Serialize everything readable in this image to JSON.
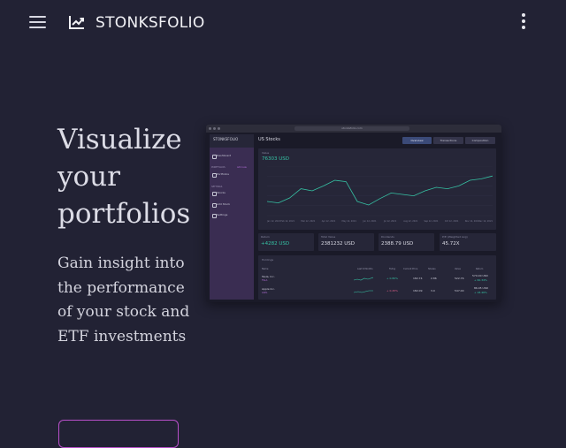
{
  "header": {
    "brand": "STONKSFOLIO",
    "menu_icon": "hamburger-menu-icon",
    "logo_icon": "trending-up-icon",
    "more_icon": "more-vertical-icon"
  },
  "hero": {
    "title": "Visualize your portfolios",
    "subtitle": "Gain insight into the performance of your stock and ETF investments"
  },
  "colors": {
    "background": "#222234",
    "accent": "#b84fc9",
    "positive": "#36c2a4"
  },
  "preview": {
    "url": "stonksfolio.com",
    "sidebar": {
      "brand": "STONKSFOLIO",
      "items": [
        "Dashboard",
        "Portfolios",
        "Stocks",
        "Add Stock",
        "Settings",
        "Logout"
      ],
      "sections": [
        "PORTFOLIOS",
        "SETTINGS"
      ],
      "action": "Add new"
    },
    "title": "US Stocks",
    "tabs": [
      "Overview",
      "Transactions",
      "Composition"
    ],
    "chart": {
      "label": "Value",
      "value": "76303 USD"
    },
    "stats": [
      {
        "label": "Return",
        "value": "+4282 USD",
        "positive": true
      },
      {
        "label": "Total Value",
        "value": "2381232 USD",
        "positive": false
      },
      {
        "label": "Dividends",
        "value": "2388.79 USD",
        "positive": false
      },
      {
        "label": "P/E (Weighted Avg)",
        "value": "45.72X",
        "positive": false
      }
    ],
    "holdings": {
      "title": "Holdings",
      "columns": [
        "Name",
        "Last 6 Months",
        "Today",
        "Current Price",
        "Shares",
        "Value",
        "Return"
      ],
      "rows": [
        {
          "name": "Tesla, Inc.",
          "ticker": "TSLA",
          "today": "+ 0.80%",
          "price": "182.74",
          "shares": "2.86",
          "value": "522.76",
          "return": "570.00 USD",
          "return_pct": "+ 60.34%"
        },
        {
          "name": "Apple Inc.",
          "ticker": "AAPL",
          "today": "+ 0.45%",
          "price": "182.09",
          "shares": "3.0",
          "value": "547.00",
          "return": "86.45 USD",
          "return_pct": "+ 18.46%"
        }
      ]
    }
  },
  "chart_data": {
    "type": "line",
    "title": "",
    "ylabel": "Value",
    "xlabel": "",
    "x": [
      "Jan 12, 2021",
      "Feb 12, 2021",
      "Mar 12, 2021",
      "Apr 12, 2021",
      "May 12, 2021",
      "Jun 12, 2021",
      "Jul 12, 2021",
      "Aug 12, 2021",
      "Sep 12, 2021",
      "Oct 12, 2021",
      "Nov 12, 2021",
      "Dec 12, 2021"
    ],
    "series": [
      {
        "values": [
          40,
          38,
          45,
          58,
          55,
          62,
          70,
          68,
          40,
          35,
          44,
          52,
          50,
          48,
          55,
          60,
          58,
          62,
          70,
          72,
          76
        ]
      }
    ],
    "ylim": [
      20,
      90
    ],
    "grid": true
  }
}
